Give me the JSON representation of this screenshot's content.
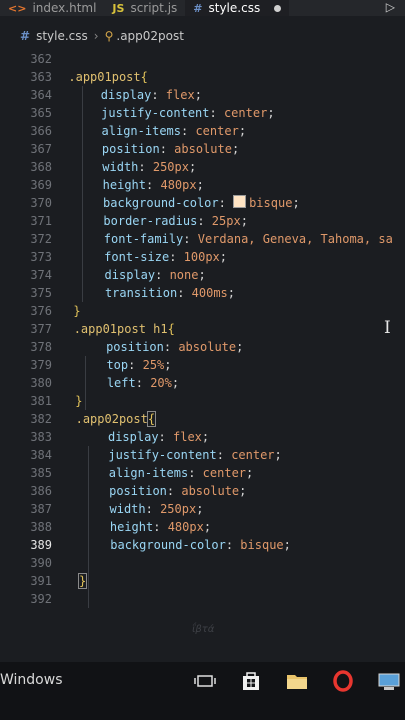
{
  "tabs": [
    {
      "label": "index.html",
      "icon": "html-icon",
      "glyph": "<>",
      "active": false
    },
    {
      "label": "script.js",
      "icon": "js-icon",
      "glyph": "JS",
      "active": false
    },
    {
      "label": "style.css",
      "icon": "css-icon",
      "glyph": "#",
      "active": true
    }
  ],
  "breadcrumb": {
    "file": "style.css",
    "selector": ".app02post"
  },
  "cursor_line": 389,
  "colors": {
    "bisque": "#ffe4c4",
    "selector": "#e0c070",
    "property": "#9ad6f4",
    "value": "#e0996a"
  },
  "code_lines": [
    {
      "n": "362",
      "indent": 0,
      "t": []
    },
    {
      "n": "363",
      "indent": 0,
      "t": [
        {
          "c": "sel",
          "s": ".app01post"
        },
        {
          "c": "brace",
          "s": "{"
        }
      ]
    },
    {
      "n": "364",
      "indent": 1,
      "t": [
        {
          "c": "prop",
          "s": "display"
        },
        {
          "c": "pun",
          "s": ": "
        },
        {
          "c": "val",
          "s": "flex"
        },
        {
          "c": "pun",
          "s": ";"
        }
      ]
    },
    {
      "n": "365",
      "indent": 1,
      "t": [
        {
          "c": "prop",
          "s": "justify-content"
        },
        {
          "c": "pun",
          "s": ": "
        },
        {
          "c": "val",
          "s": "center"
        },
        {
          "c": "pun",
          "s": ";"
        }
      ]
    },
    {
      "n": "366",
      "indent": 1,
      "t": [
        {
          "c": "prop",
          "s": "align-items"
        },
        {
          "c": "pun",
          "s": ": "
        },
        {
          "c": "val",
          "s": "center"
        },
        {
          "c": "pun",
          "s": ";"
        }
      ]
    },
    {
      "n": "367",
      "indent": 1,
      "t": [
        {
          "c": "prop",
          "s": "position"
        },
        {
          "c": "pun",
          "s": ": "
        },
        {
          "c": "val",
          "s": "absolute"
        },
        {
          "c": "pun",
          "s": ";"
        }
      ]
    },
    {
      "n": "368",
      "indent": 1,
      "t": [
        {
          "c": "prop",
          "s": "width"
        },
        {
          "c": "pun",
          "s": ": "
        },
        {
          "c": "val",
          "s": "250px"
        },
        {
          "c": "pun",
          "s": ";"
        }
      ]
    },
    {
      "n": "369",
      "indent": 1,
      "t": [
        {
          "c": "prop",
          "s": "height"
        },
        {
          "c": "pun",
          "s": ": "
        },
        {
          "c": "val",
          "s": "480px"
        },
        {
          "c": "pun",
          "s": ";"
        }
      ]
    },
    {
      "n": "370",
      "indent": 1,
      "t": [
        {
          "c": "prop",
          "s": "background-color"
        },
        {
          "c": "pun",
          "s": ": "
        },
        {
          "c": "swatch",
          "s": ""
        },
        {
          "c": "val",
          "s": "bisque"
        },
        {
          "c": "pun",
          "s": ";"
        }
      ]
    },
    {
      "n": "371",
      "indent": 1,
      "t": [
        {
          "c": "prop",
          "s": "border-radius"
        },
        {
          "c": "pun",
          "s": ": "
        },
        {
          "c": "val",
          "s": "25px"
        },
        {
          "c": "pun",
          "s": ";"
        }
      ]
    },
    {
      "n": "372",
      "indent": 1,
      "t": [
        {
          "c": "prop",
          "s": "font-family"
        },
        {
          "c": "pun",
          "s": ": "
        },
        {
          "c": "val",
          "s": "Verdana, Geneva, Tahoma, sa"
        }
      ]
    },
    {
      "n": "373",
      "indent": 1,
      "t": [
        {
          "c": "prop",
          "s": "font-size"
        },
        {
          "c": "pun",
          "s": ": "
        },
        {
          "c": "val",
          "s": "100px"
        },
        {
          "c": "pun",
          "s": ";"
        }
      ]
    },
    {
      "n": "374",
      "indent": 1,
      "t": [
        {
          "c": "prop",
          "s": "display"
        },
        {
          "c": "pun",
          "s": ": "
        },
        {
          "c": "val",
          "s": "none"
        },
        {
          "c": "pun",
          "s": ";"
        }
      ]
    },
    {
      "n": "375",
      "indent": 1,
      "t": [
        {
          "c": "prop",
          "s": "transition"
        },
        {
          "c": "pun",
          "s": ": "
        },
        {
          "c": "val",
          "s": "400ms"
        },
        {
          "c": "pun",
          "s": ";"
        }
      ]
    },
    {
      "n": "376",
      "indent": 0,
      "t": [
        {
          "c": "brace",
          "s": "}"
        }
      ]
    },
    {
      "n": "377",
      "indent": 0,
      "t": [
        {
          "c": "sel",
          "s": ".app01post h1"
        },
        {
          "c": "brace",
          "s": "{"
        }
      ]
    },
    {
      "n": "378",
      "indent": 1,
      "t": [
        {
          "c": "prop",
          "s": "position"
        },
        {
          "c": "pun",
          "s": ": "
        },
        {
          "c": "val",
          "s": "absolute"
        },
        {
          "c": "pun",
          "s": ";"
        }
      ]
    },
    {
      "n": "379",
      "indent": 1,
      "t": [
        {
          "c": "prop",
          "s": "top"
        },
        {
          "c": "pun",
          "s": ": "
        },
        {
          "c": "val",
          "s": "25%"
        },
        {
          "c": "pun",
          "s": ";"
        }
      ]
    },
    {
      "n": "380",
      "indent": 1,
      "t": [
        {
          "c": "prop",
          "s": "left"
        },
        {
          "c": "pun",
          "s": ": "
        },
        {
          "c": "val",
          "s": "20%"
        },
        {
          "c": "pun",
          "s": ";"
        }
      ]
    },
    {
      "n": "381",
      "indent": 0,
      "t": [
        {
          "c": "brace",
          "s": "}"
        }
      ]
    },
    {
      "n": "382",
      "indent": 0,
      "t": [
        {
          "c": "sel",
          "s": ".app02post"
        },
        {
          "c": "brace brace-box",
          "s": "{"
        }
      ]
    },
    {
      "n": "383",
      "indent": 1,
      "t": [
        {
          "c": "prop",
          "s": "display"
        },
        {
          "c": "pun",
          "s": ": "
        },
        {
          "c": "val",
          "s": "flex"
        },
        {
          "c": "pun",
          "s": ";"
        }
      ]
    },
    {
      "n": "384",
      "indent": 1,
      "t": [
        {
          "c": "prop",
          "s": "justify-content"
        },
        {
          "c": "pun",
          "s": ": "
        },
        {
          "c": "val",
          "s": "center"
        },
        {
          "c": "pun",
          "s": ";"
        }
      ]
    },
    {
      "n": "385",
      "indent": 1,
      "t": [
        {
          "c": "prop",
          "s": "align-items"
        },
        {
          "c": "pun",
          "s": ": "
        },
        {
          "c": "val",
          "s": "center"
        },
        {
          "c": "pun",
          "s": ";"
        }
      ]
    },
    {
      "n": "386",
      "indent": 1,
      "t": [
        {
          "c": "prop",
          "s": "position"
        },
        {
          "c": "pun",
          "s": ": "
        },
        {
          "c": "val",
          "s": "absolute"
        },
        {
          "c": "pun",
          "s": ";"
        }
      ]
    },
    {
      "n": "387",
      "indent": 1,
      "t": [
        {
          "c": "prop",
          "s": "width"
        },
        {
          "c": "pun",
          "s": ": "
        },
        {
          "c": "val",
          "s": "250px"
        },
        {
          "c": "pun",
          "s": ";"
        }
      ]
    },
    {
      "n": "388",
      "indent": 1,
      "t": [
        {
          "c": "prop",
          "s": "height"
        },
        {
          "c": "pun",
          "s": ": "
        },
        {
          "c": "val",
          "s": "480px"
        },
        {
          "c": "pun",
          "s": ";"
        }
      ]
    },
    {
      "n": "389",
      "indent": 1,
      "t": [
        {
          "c": "prop",
          "s": "background-color"
        },
        {
          "c": "pun",
          "s": ": "
        },
        {
          "c": "val",
          "s": "bisque"
        },
        {
          "c": "pun",
          "s": ";"
        }
      ]
    },
    {
      "n": "390",
      "indent": 0,
      "t": []
    },
    {
      "n": "391",
      "indent": 0,
      "t": [
        {
          "c": "brace brace-box",
          "s": "}"
        }
      ]
    },
    {
      "n": "392",
      "indent": 0,
      "t": []
    }
  ],
  "taskbar": {
    "label": "Windows",
    "icons": [
      "task-view-icon",
      "store-icon",
      "file-explorer-icon",
      "opera-icon",
      "computer-icon"
    ]
  }
}
